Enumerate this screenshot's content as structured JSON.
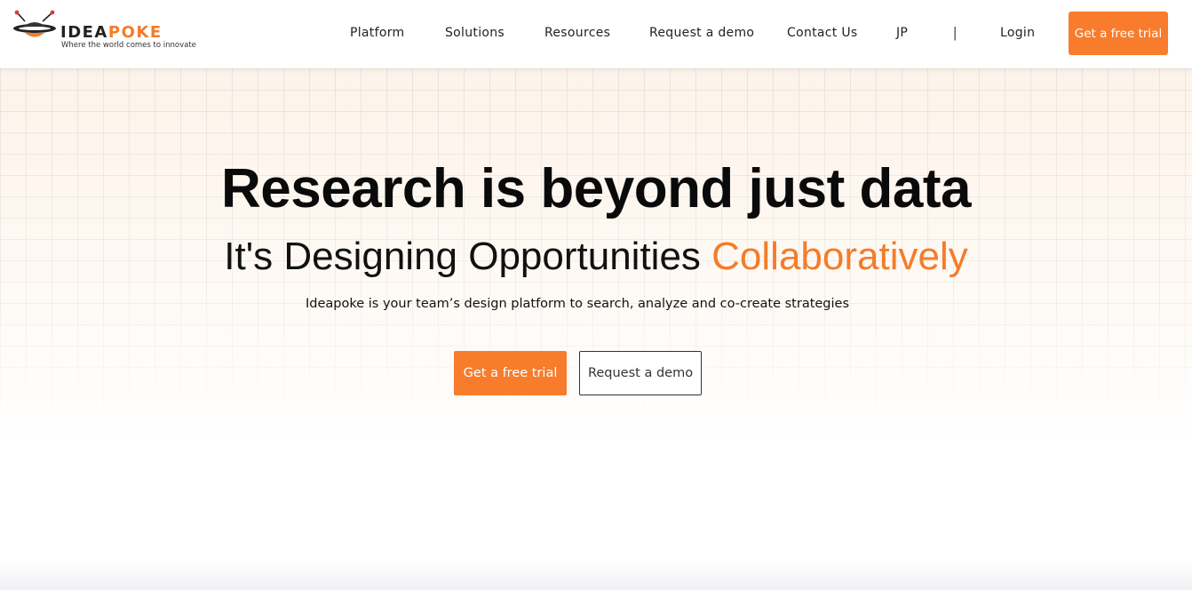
{
  "brand": {
    "name_part1": "IDEA",
    "name_part2": "POKE",
    "tagline": "Where the world comes to innovate",
    "accent_color": "#f47c2a"
  },
  "nav": {
    "items": [
      {
        "label": "Platform"
      },
      {
        "label": "Solutions"
      },
      {
        "label": "Resources"
      },
      {
        "label": "Request a demo"
      },
      {
        "label": "Contact Us"
      },
      {
        "label": "JP"
      }
    ],
    "separator": "|",
    "login": "Login",
    "cta": "Get a free trial"
  },
  "hero": {
    "title": "Research is beyond just data",
    "subtitle_prefix": "It's Designing Opportunities ",
    "subtitle_accent": "Collaboratively",
    "description": "Ideapoke is your team’s design platform to search, analyze and co-create strategies",
    "primary_button": "Get a free trial",
    "secondary_button": "Request a demo"
  }
}
